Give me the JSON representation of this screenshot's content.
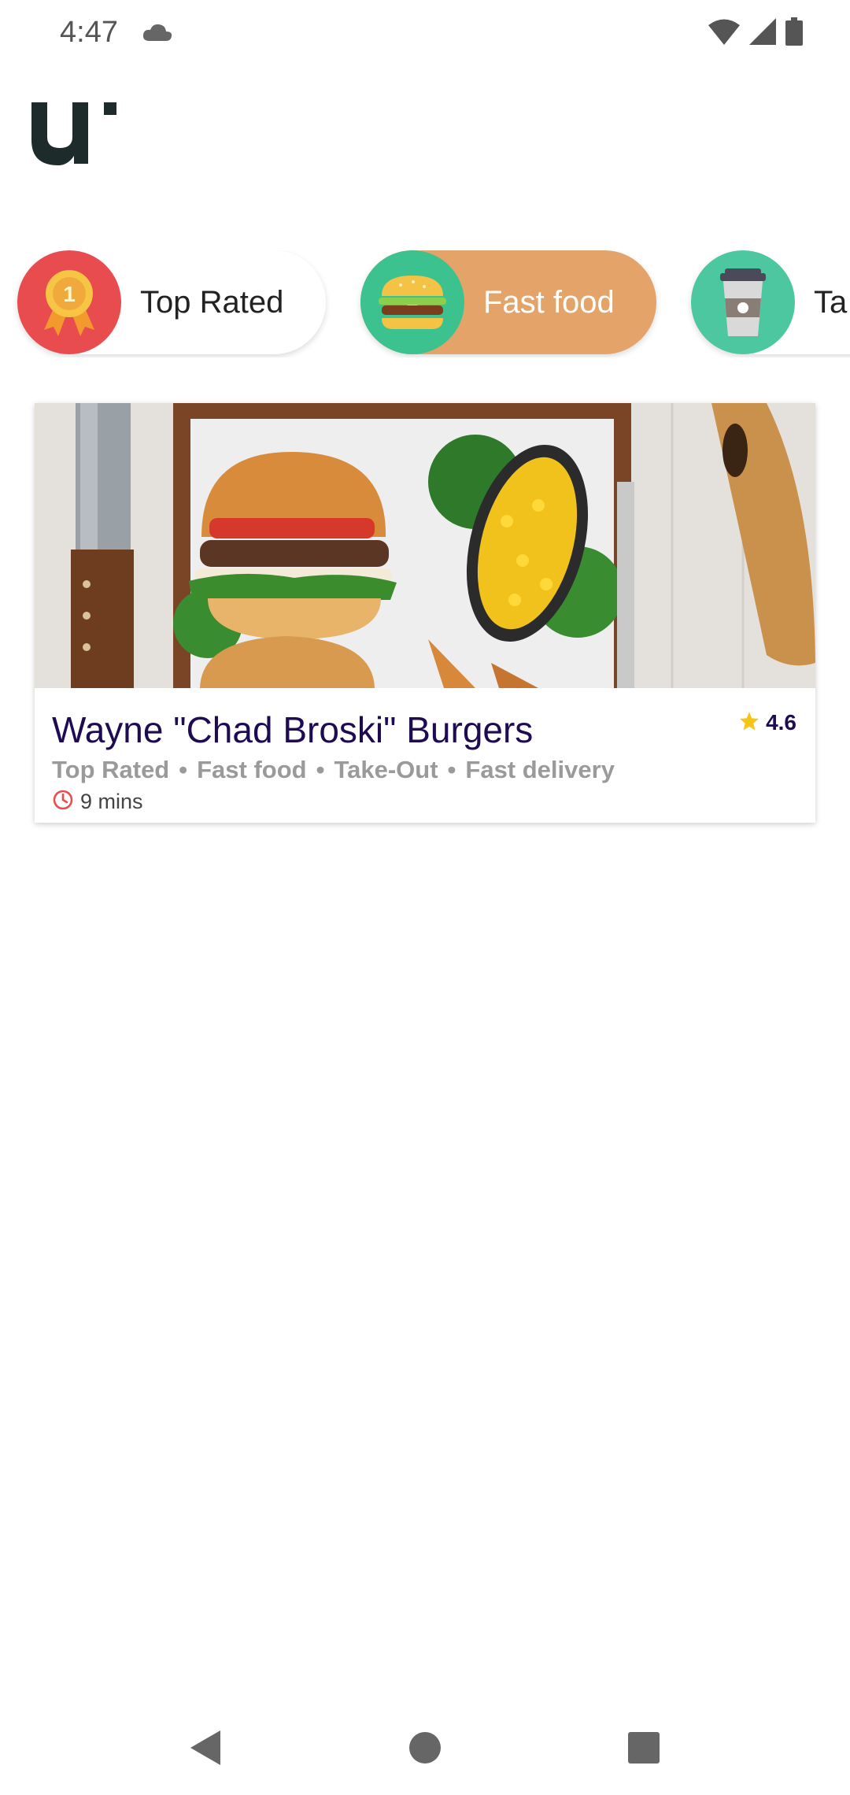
{
  "status_bar": {
    "time": "4:47",
    "icons": [
      "cloud-icon",
      "wifi-icon",
      "signal-icon",
      "battery-icon"
    ]
  },
  "logo": {
    "text": "U"
  },
  "categories": [
    {
      "label": "Top Rated",
      "icon": "medal-icon",
      "color": "#e84c4f",
      "selected": false
    },
    {
      "label": "Fast food",
      "icon": "burger-icon",
      "color": "#3cc28e",
      "selected": true,
      "selected_bg": "#e4a368"
    },
    {
      "label": "Take-Out",
      "visible_label": "Ta",
      "icon": "coffee-cup-icon",
      "color": "#4cc7a0",
      "selected": false
    }
  ],
  "restaurants": [
    {
      "name": "Wayne \"Chad Broski\" Burgers",
      "rating": "4.6",
      "tags": [
        "Top Rated",
        "Fast food",
        "Take-Out",
        "Fast delivery"
      ],
      "tag_separator": "•",
      "delivery_time": "9 mins"
    }
  ],
  "colors": {
    "restaurant_name": "#1e0b52",
    "tags": "#9a9a9a",
    "star": "#f5c518",
    "clock": "#e84c4f"
  },
  "nav_bar": {
    "buttons": [
      "back-button",
      "home-button",
      "recents-button"
    ]
  }
}
